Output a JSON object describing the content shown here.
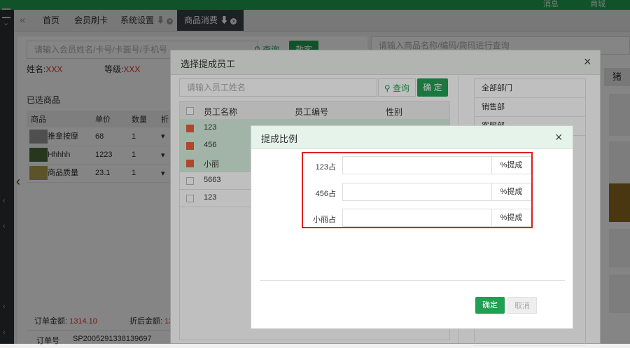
{
  "topbar": {
    "messages": "消息",
    "personal": "商城"
  },
  "tabs": [
    {
      "label": "首页"
    },
    {
      "label": "会员刷卡"
    },
    {
      "label": "系统设置"
    },
    {
      "label": "商品消费"
    }
  ],
  "member": {
    "search_placeholder": "请输入会员姓名/卡号/卡面号/手机号",
    "search_label": "查询",
    "anon_label": "散客",
    "name_label": "姓名:",
    "name_value": "XXX",
    "level_label": "等级:",
    "level_value": "XXX"
  },
  "selected_goods": {
    "title": "已选商品",
    "headers": [
      "商品",
      "单价",
      "数量",
      "折"
    ],
    "rows": [
      {
        "name": "推拿按摩",
        "price": "68",
        "qty": "1"
      },
      {
        "name": "Hhhhh",
        "price": "1223",
        "qty": "1"
      },
      {
        "name": "商品质量",
        "price": "23.1",
        "qty": "1"
      }
    ],
    "order_amount_label": "订单金额:",
    "order_amount": "1314.10",
    "discount_amount_label": "折后金额:",
    "discount_amount": "13",
    "order_no_label": "订单号",
    "order_no": "SP2005291338139697"
  },
  "product_search": {
    "placeholder": "请输入商品名称/编码/简码进行查询",
    "category_partial": "猪"
  },
  "staff_modal": {
    "title": "选择提成员工",
    "search_placeholder": "请输入员工姓名",
    "search_label": "查询",
    "confirm_label": "确 定",
    "headers": [
      "员工名称",
      "员工编号",
      "性别"
    ],
    "rows": [
      {
        "name": "123",
        "checked": true
      },
      {
        "name": "456",
        "checked": true
      },
      {
        "name": "小丽",
        "checked": true
      },
      {
        "name": "5663",
        "checked": false
      },
      {
        "name": "123",
        "checked": false
      }
    ],
    "departments": [
      "全部部门",
      "销售部",
      "客服部"
    ]
  },
  "ratio_modal": {
    "title": "提成比例",
    "rows": [
      {
        "label": "123占",
        "value": "",
        "suffix": "%提成"
      },
      {
        "label": "456占",
        "value": "",
        "suffix": "%提成"
      },
      {
        "label": "小丽占",
        "value": "",
        "suffix": "%提成"
      }
    ],
    "confirm_label": "确定",
    "cancel_label": "取消"
  },
  "colors": {
    "brand": "#20a052",
    "highlight_border": "#e02020",
    "checked": "#e8613c"
  }
}
